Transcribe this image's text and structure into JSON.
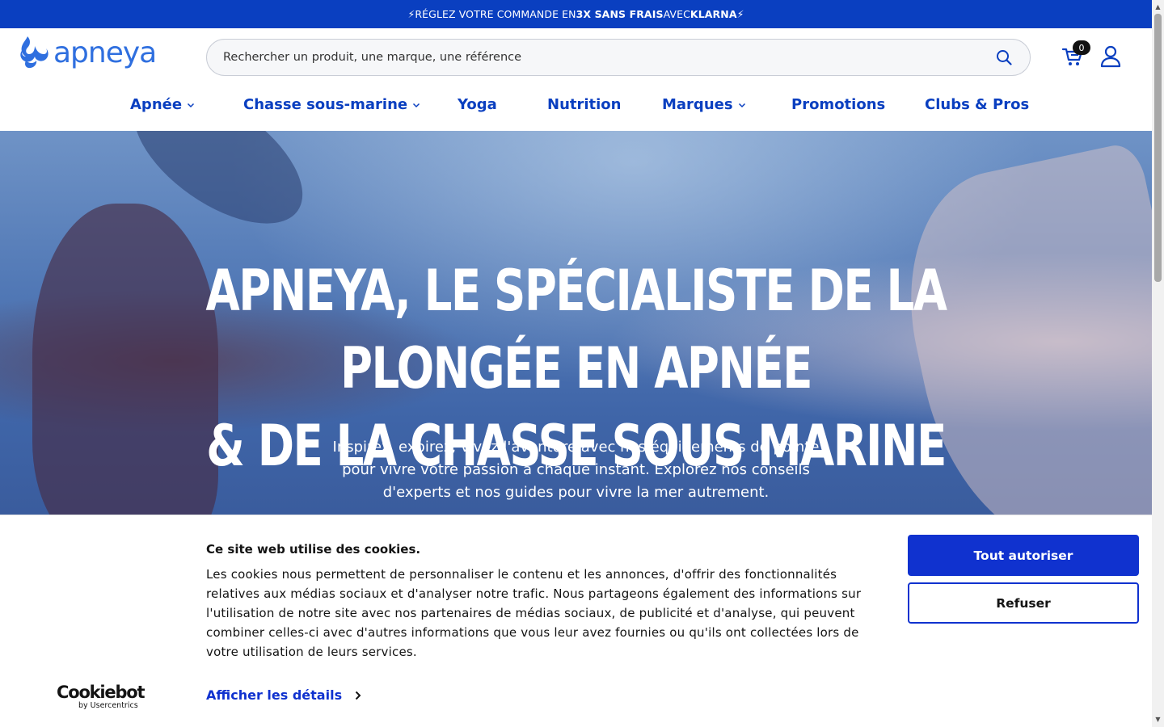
{
  "topbar": {
    "prefix": "⚡RÉGLEZ VOTRE COMMANDE EN ",
    "bold1": "3X SANS FRAIS",
    "middle": " AVEC ",
    "bold2": "KLARNA",
    "suffix": "⚡"
  },
  "header": {
    "logo_text": "apneya",
    "search_placeholder": "Rechercher un produit, une marque, une référence",
    "cart_count": "0",
    "icons": {
      "search": "search-icon",
      "cart": "cart-icon",
      "account": "user-icon"
    }
  },
  "nav": {
    "items": [
      {
        "label": "Apnée",
        "dropdown": true
      },
      {
        "label": "Chasse sous-marine",
        "dropdown": true
      },
      {
        "label": "Yoga",
        "dropdown": false
      },
      {
        "label": "Nutrition",
        "dropdown": false
      },
      {
        "label": "Marques",
        "dropdown": true
      },
      {
        "label": "Promotions",
        "dropdown": false
      },
      {
        "label": "Clubs & Pros",
        "dropdown": false
      }
    ]
  },
  "hero": {
    "title_line1": "APNEYA, LE SPÉCIALISTE DE LA PLONGÉE EN APNÉE",
    "title_line2": "& DE LA CHASSE SOUS MARINE",
    "subtitle": "Inspirez, expirez, vivez l'aventure avec nos équipements de pointe pour vivre votre passion à chaque instant. Explorez nos conseils d'experts et nos guides pour vivre la mer autrement."
  },
  "cookie": {
    "brand": "Cookiebot",
    "brand_by": "by Usercentrics",
    "title": "Ce site web utilise des cookies.",
    "text": "Les cookies nous permettent de personnaliser le contenu et les annonces, d'offrir des fonctionnalités relatives aux médias sociaux et d'analyser notre trafic. Nous partageons également des informations sur l'utilisation de notre site avec nos partenaires de médias sociaux, de publicité et d'analyse, qui peuvent combiner celles-ci avec d'autres informations que vous leur avez fournies ou qu'ils ont collectées lors de votre utilisation de leurs services.",
    "details_label": "Afficher les détails",
    "allow_label": "Tout autoriser",
    "refuse_label": "Refuser"
  },
  "colors": {
    "brand_blue": "#0a3fc0",
    "logo_blue": "#2f6fdf",
    "cookie_blue": "#1032cf"
  }
}
